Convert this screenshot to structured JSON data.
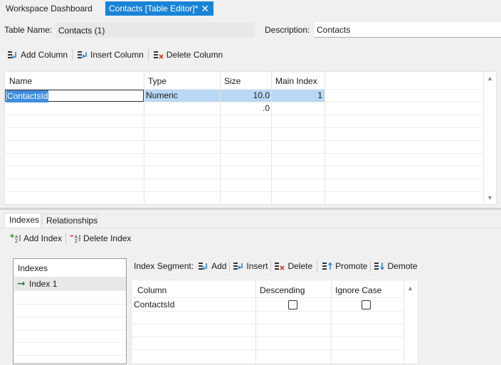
{
  "tabs": {
    "workspace": "Workspace Dashboard",
    "contacts": "Contacts [Table Editor]*",
    "close_glyph": "✕"
  },
  "header": {
    "table_name_label": "Table Name:",
    "table_name_value": "Contacts (1)",
    "description_label": "Description:",
    "description_value": "Contacts"
  },
  "toolbar": {
    "add_column": "Add Column",
    "insert_column": "Insert Column",
    "delete_column": "Delete Column"
  },
  "columns_grid": {
    "headers": [
      "Name",
      "Type",
      "Size",
      "Main Index"
    ],
    "rows": [
      {
        "name": "ContactsId",
        "type": "Numeric",
        "size": "10.0",
        "main_index": "1"
      },
      {
        "name": "",
        "type": "",
        "size": ".0",
        "main_index": ""
      }
    ]
  },
  "lower_tabs": {
    "indexes": "Indexes",
    "relationships": "Relationships"
  },
  "index_toolbar": {
    "add_index": "Add Index",
    "delete_index": "Delete Index"
  },
  "indexes_list": {
    "header": "Indexes",
    "items": [
      "Index 1"
    ]
  },
  "segment_toolbar": {
    "label": "Index Segment:",
    "add": "Add",
    "insert": "Insert",
    "delete": "Delete",
    "promote": "Promote",
    "demote": "Demote"
  },
  "segment_grid": {
    "headers": [
      "Column",
      "Descending",
      "Ignore Case"
    ],
    "rows": [
      {
        "column": "ContactsId",
        "descending": false,
        "ignore_case": false
      }
    ]
  },
  "colors": {
    "accent": "#1883d7",
    "selection": "#b9d8f5",
    "index_arrow": "#1f7a3a"
  }
}
